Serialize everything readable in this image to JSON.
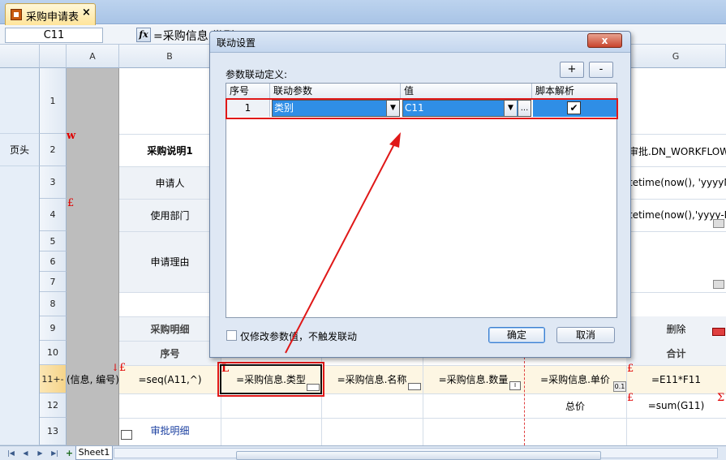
{
  "tab": {
    "title": "采购申请表",
    "close": "×"
  },
  "formula_bar": {
    "cell_ref": "C11",
    "fx": "fx",
    "formula": "=采购信息.类型"
  },
  "columns": [
    "A",
    "B",
    "G"
  ],
  "rows": {
    "numbers": [
      "1",
      "2",
      "3",
      "4",
      "5",
      "6",
      "7",
      "8",
      "9",
      "10",
      "11+-",
      "12",
      "13"
    ],
    "page_header": "页头"
  },
  "cells": {
    "a11": "(信息, 编号)",
    "b2": "采购说明1",
    "b3": "申请人",
    "b4": "使用部门",
    "b5": "申请理由",
    "b9": "采购明细",
    "b10": "序号",
    "b11": "=seq(A11,^)",
    "c11": "=采购信息.类型",
    "d11": "=采购信息.名称",
    "e11": "=采购信息.数量",
    "f11": "=采购信息.单价",
    "f12": "总价",
    "b13": "审批明细",
    "g2": "审批.DN_WORKFLOW",
    "g3": "tetime(now(), 'yyyyM",
    "g4": "tetime(now(),'yyyy-M",
    "g9": "删除",
    "g10": "合计",
    "g11": "=E11*F11",
    "g12": "=sum(G11)"
  },
  "marks": {
    "w": "w",
    "pound": "£",
    "L": "L",
    "sigma": "Σ",
    "arrow_down": "↓",
    "f11_small": "0.1"
  },
  "dialog": {
    "title": "联动设置",
    "close": "x",
    "section_label": "参数联动定义:",
    "add_label": "+",
    "remove_label": "-",
    "headers": [
      "序号",
      "联动参数",
      "值",
      "脚本解析"
    ],
    "row": {
      "index": "1",
      "param": "类别",
      "value": "C11",
      "ellipsis": "...",
      "script_checked": "✔"
    },
    "checkbox_label": "仅修改参数值，不触发联动",
    "ok_label": "确定",
    "cancel_label": "取消"
  },
  "sheet": {
    "tab": "Sheet1",
    "add": "+"
  },
  "colors": {
    "highlight_red": "#e01818",
    "selection_blue": "#2f8ee6"
  }
}
